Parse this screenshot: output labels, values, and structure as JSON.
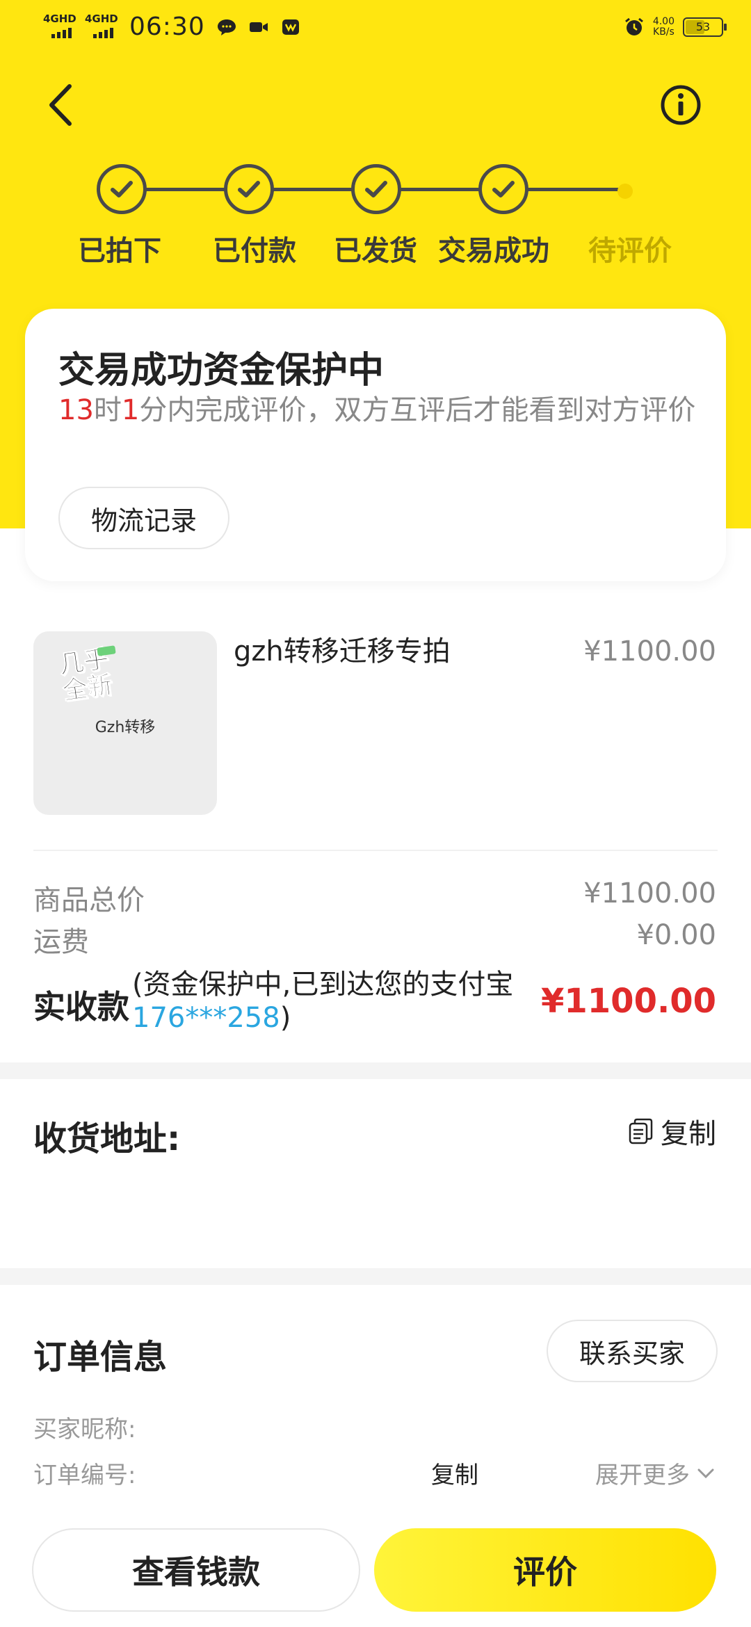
{
  "status_bar": {
    "network1": "4GHD",
    "network2": "4GHD",
    "time": "06:30",
    "speed_value": "4.00",
    "speed_unit": "KB/s",
    "battery": "53",
    "battery_level": 0.53
  },
  "steps": [
    {
      "label": "已拍下",
      "done": true
    },
    {
      "label": "已付款",
      "done": true
    },
    {
      "label": "已发货",
      "done": true
    },
    {
      "label": "交易成功",
      "done": true
    },
    {
      "label": "待评价",
      "done": false
    }
  ],
  "status_card": {
    "title": "交易成功资金保护中",
    "hours": "13",
    "hours_unit": "时",
    "minutes": "1",
    "desc_rest": "分内完成评价，双方互评后才能看到对方评价",
    "logistics_button": "物流记录"
  },
  "product": {
    "thumb_badge_line1": "几乎",
    "thumb_badge_line2": "全新",
    "thumb_text": "Gzh转移",
    "title": "gzh转移迁移专拍",
    "price": "¥1100.00"
  },
  "fees": {
    "goods_total_label": "商品总价",
    "goods_total_value": "¥1100.00",
    "shipping_label": "运费",
    "shipping_value": "¥0.00",
    "received_label": "实收款",
    "received_note_prefix": "(资金保护中,已到达您的支付宝",
    "received_account": "176***258",
    "received_note_suffix": ")",
    "received_value": "¥1100.00"
  },
  "address": {
    "title": "收货地址:",
    "copy_label": "复制"
  },
  "order_info": {
    "title": "订单信息",
    "contact_button": "联系买家",
    "buyer_nickname_label": "买家昵称:",
    "order_number_label": "订单编号:",
    "copy_label": "复制",
    "expand_label": "展开更多"
  },
  "bottom_bar": {
    "view_funds": "查看钱款",
    "rate": "评价"
  },
  "colors": {
    "brand_yellow": "#ffe610",
    "price_red": "#e02b2b",
    "account_blue": "#2aa6e0"
  },
  "icons": [
    "back-icon",
    "info-icon",
    "check-icon",
    "copy-icon",
    "chevron-down-icon",
    "message-icon",
    "video-icon",
    "alarm-icon"
  ]
}
